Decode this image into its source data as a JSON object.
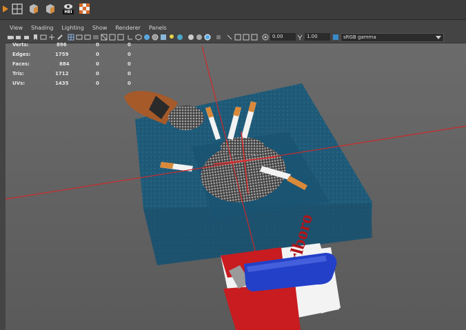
{
  "toolbar": {
    "hei_label": "HEI"
  },
  "menu": [
    "View",
    "Shading",
    "Lighting",
    "Show",
    "Renderer",
    "Panels"
  ],
  "viewport_controls": {
    "exposure_value": "0.00",
    "gamma_value": "1.00",
    "colorspace_value": "sRGB gamma"
  },
  "hud": {
    "rows": [
      {
        "label": "Verts:",
        "v1": "896",
        "v2": "0",
        "v3": "0"
      },
      {
        "label": "Edges:",
        "v1": "1759",
        "v2": "0",
        "v3": "0"
      },
      {
        "label": "Faces:",
        "v1": "884",
        "v2": "0",
        "v3": "0"
      },
      {
        "label": "Tris:",
        "v1": "1712",
        "v2": "0",
        "v3": "0"
      },
      {
        "label": "UVs:",
        "v1": "1435",
        "v2": "0",
        "v3": "0"
      }
    ]
  },
  "scene": {
    "pack_brand": "Marlboro",
    "colors": {
      "ashtray": "#1f5a78",
      "grid_line": "#cc2a2a",
      "lighter": "#2340c8",
      "pack_red": "#c81c20"
    }
  }
}
